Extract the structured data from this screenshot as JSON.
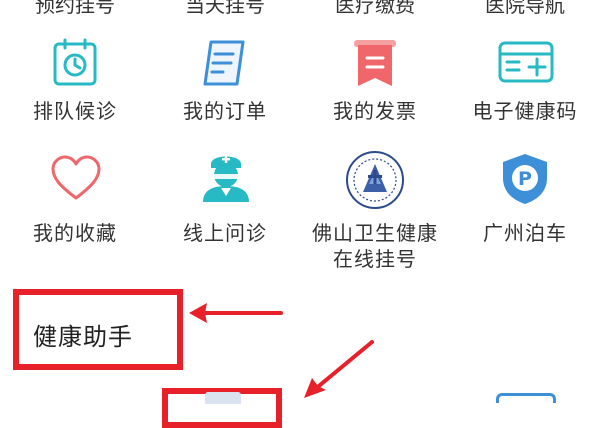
{
  "top_row_cut": [
    {
      "label": "预约挂号"
    },
    {
      "label": "当天挂号"
    },
    {
      "label": "医疗缴费"
    },
    {
      "label": "医院导航"
    }
  ],
  "grid": [
    {
      "label": "排队候诊",
      "icon": "clock-icon"
    },
    {
      "label": "我的订单",
      "icon": "document-icon"
    },
    {
      "label": "我的发票",
      "icon": "receipt-icon"
    },
    {
      "label": "电子健康码",
      "icon": "health-card-icon"
    },
    {
      "label": "我的收藏",
      "icon": "heart-icon"
    },
    {
      "label": "线上问诊",
      "icon": "nurse-icon"
    },
    {
      "label": "佛山卫生健康在线挂号",
      "label_line1": "佛山卫生健康",
      "label_line2": "在线挂号",
      "icon": "emblem-icon"
    },
    {
      "label": "广州泊车",
      "icon": "parking-icon"
    }
  ],
  "section": {
    "title": "健康助手"
  },
  "colors": {
    "accent_teal": "#27b9c4",
    "accent_blue": "#3d8fd8",
    "accent_red": "#f0676b",
    "annotation_red": "#e8202a"
  }
}
